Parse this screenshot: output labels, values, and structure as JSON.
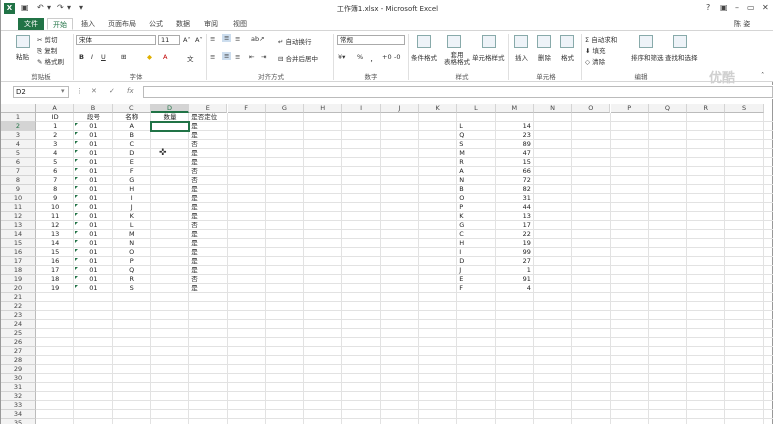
{
  "titlebar": {
    "doc_title": "工作簿1.xlsx - Microsoft Excel",
    "help": "?",
    "minimize": "–",
    "restore": "▭",
    "close": "✕",
    "user": "陈 姿"
  },
  "tabs": [
    "文件",
    "开始",
    "插入",
    "页面布局",
    "公式",
    "数据",
    "审阅",
    "视图"
  ],
  "ribbon": {
    "paste": "粘贴",
    "cut": "剪切",
    "copy": "复制",
    "format_painter": "格式刷",
    "clipboard": "剪贴板",
    "font_name": "宋体",
    "font_size": "11",
    "font_group": "字体",
    "wrap_text": "自动换行",
    "merge_center": "合并后居中",
    "alignment_group": "对齐方式",
    "number_format": "常规",
    "percent": "%",
    "comma": "，",
    "number_group": "数字",
    "conditional_format": "条件格式",
    "format_as_table": "套用\n表格格式",
    "cell_styles": "单元格样式",
    "styles_group": "样式",
    "insert": "插入",
    "delete": "删除",
    "format": "格式",
    "cells_group": "单元格",
    "autosum": "自动求和",
    "fill": "填充",
    "clear": "清除",
    "sort_filter": "排序和筛选",
    "find_select": "查找和选择",
    "editing_group": "编辑"
  },
  "watermark": "优酷",
  "formula": {
    "namebox": "D2",
    "cancel": "✕",
    "enter": "✓",
    "fx": "fx",
    "content": ""
  },
  "sheet": {
    "columns": [
      "A",
      "B",
      "C",
      "D",
      "E",
      "F",
      "G",
      "H",
      "I",
      "J",
      "K",
      "L",
      "M",
      "N",
      "O",
      "P",
      "Q",
      "R",
      "S"
    ],
    "selected_col": "D",
    "selected_row": 2,
    "rows": 35,
    "header": {
      "A": "ID",
      "B": "段号",
      "C": "名称",
      "D": "数量",
      "E": "是否定位"
    },
    "data": [
      {
        "id": "1",
        "seg": "01",
        "name": "A",
        "pos": "是",
        "l": "L",
        "m": "14"
      },
      {
        "id": "2",
        "seg": "01",
        "name": "B",
        "pos": "是",
        "l": "Q",
        "m": "23"
      },
      {
        "id": "3",
        "seg": "01",
        "name": "C",
        "pos": "否",
        "l": "S",
        "m": "89"
      },
      {
        "id": "4",
        "seg": "01",
        "name": "D",
        "pos": "是",
        "l": "M",
        "m": "47"
      },
      {
        "id": "5",
        "seg": "01",
        "name": "E",
        "pos": "是",
        "l": "R",
        "m": "15"
      },
      {
        "id": "6",
        "seg": "01",
        "name": "F",
        "pos": "否",
        "l": "A",
        "m": "66"
      },
      {
        "id": "7",
        "seg": "01",
        "name": "G",
        "pos": "否",
        "l": "N",
        "m": "72"
      },
      {
        "id": "8",
        "seg": "01",
        "name": "H",
        "pos": "是",
        "l": "B",
        "m": "82"
      },
      {
        "id": "9",
        "seg": "01",
        "name": "I",
        "pos": "是",
        "l": "O",
        "m": "31"
      },
      {
        "id": "10",
        "seg": "01",
        "name": "J",
        "pos": "是",
        "l": "P",
        "m": "44"
      },
      {
        "id": "11",
        "seg": "01",
        "name": "K",
        "pos": "是",
        "l": "K",
        "m": "13"
      },
      {
        "id": "12",
        "seg": "01",
        "name": "L",
        "pos": "否",
        "l": "G",
        "m": "17"
      },
      {
        "id": "13",
        "seg": "01",
        "name": "M",
        "pos": "是",
        "l": "C",
        "m": "22"
      },
      {
        "id": "14",
        "seg": "01",
        "name": "N",
        "pos": "是",
        "l": "H",
        "m": "19"
      },
      {
        "id": "15",
        "seg": "01",
        "name": "O",
        "pos": "是",
        "l": "I",
        "m": "99"
      },
      {
        "id": "16",
        "seg": "01",
        "name": "P",
        "pos": "是",
        "l": "D",
        "m": "27"
      },
      {
        "id": "17",
        "seg": "01",
        "name": "Q",
        "pos": "是",
        "l": "J",
        "m": "1"
      },
      {
        "id": "18",
        "seg": "01",
        "name": "R",
        "pos": "否",
        "l": "E",
        "m": "91"
      },
      {
        "id": "19",
        "seg": "01",
        "name": "S",
        "pos": "是",
        "l": "F",
        "m": "4"
      }
    ]
  }
}
